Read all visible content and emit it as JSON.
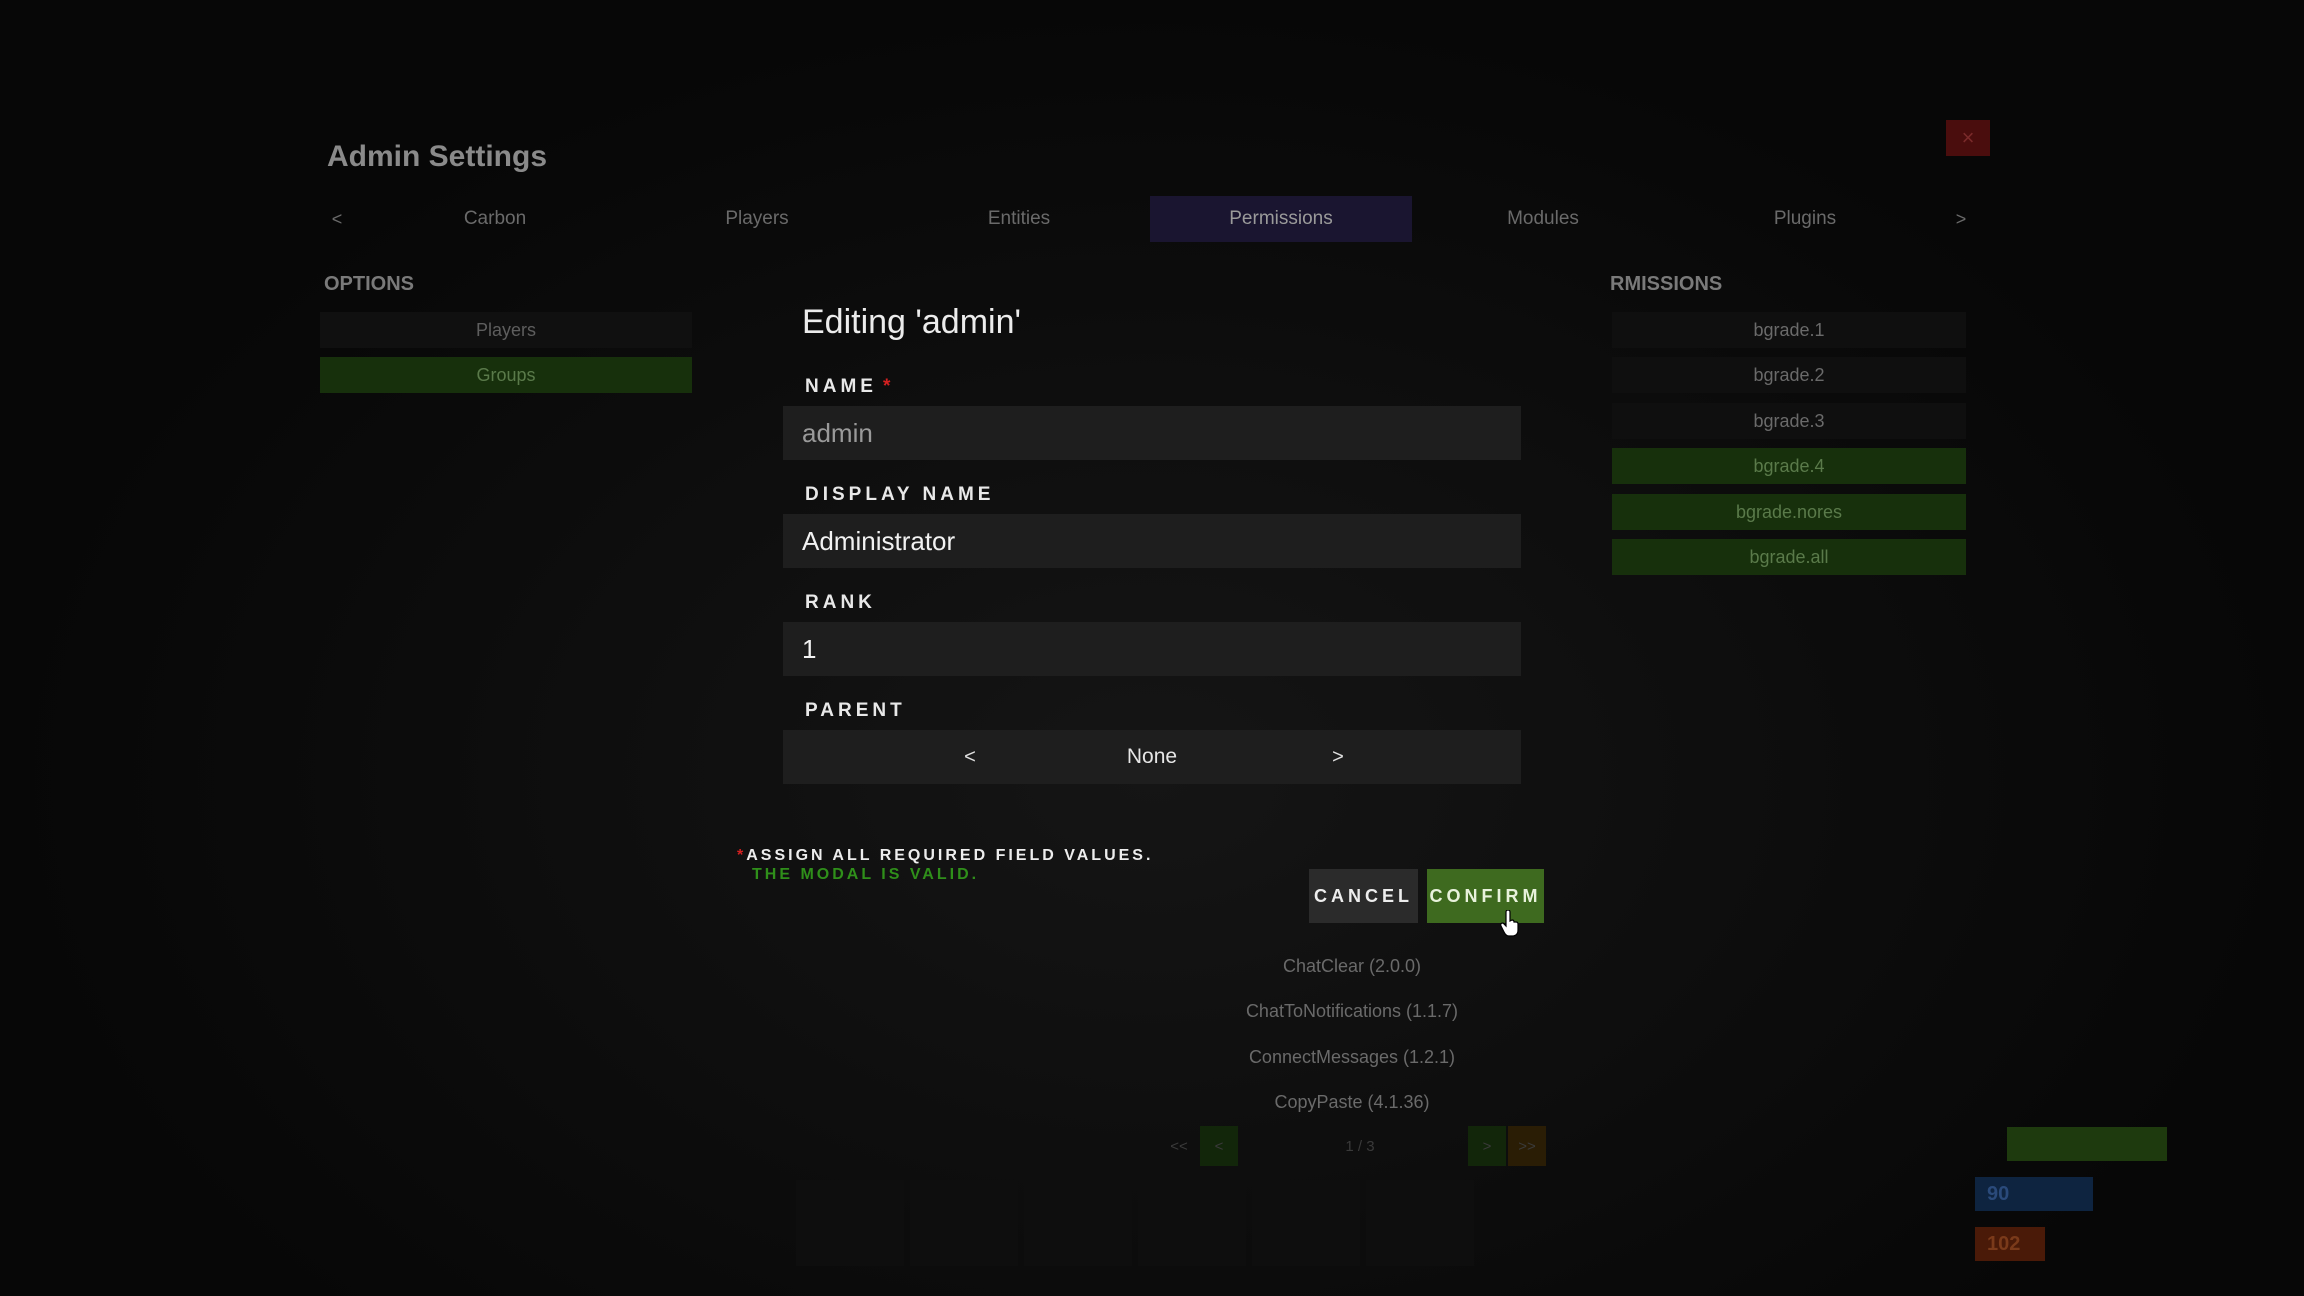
{
  "colors": {
    "background": "#0a0a0a",
    "accent_green": "#3e6a1f",
    "valid_text": "#2f8f1a",
    "required_red": "#d42020",
    "field_bg": "#1e1e1e"
  },
  "background_panel": {
    "title": "Admin Settings",
    "close_label": "×",
    "tabs": {
      "prev": "<",
      "next": ">",
      "items": [
        "Carbon",
        "Players",
        "Entities",
        "Permissions",
        "Modules",
        "Plugins"
      ],
      "active": "Permissions"
    },
    "options": {
      "heading": "OPTIONS",
      "items": [
        "Players",
        "Groups"
      ],
      "selected": "Groups"
    },
    "permissions": {
      "heading": "RMISSIONS",
      "items": [
        "bgrade.1",
        "bgrade.2",
        "bgrade.3",
        "bgrade.4",
        "bgrade.nores",
        "bgrade.all"
      ],
      "enabled": [
        "bgrade.4",
        "bgrade.nores",
        "bgrade.all"
      ]
    },
    "plugins": [
      "ChatClear (2.0.0)",
      "ChatToNotifications (1.1.7)",
      "ConnectMessages (1.2.1)",
      "CopyPaste (4.1.36)"
    ],
    "pager": {
      "first": "<<",
      "prev": "<",
      "page": "1 / 3",
      "next": ">",
      "last": ">>"
    },
    "stats": {
      "water": "90",
      "food": "102"
    }
  },
  "modal": {
    "title": "Editing 'admin'",
    "fields": {
      "name": {
        "label": "NAME",
        "required_mark": "*",
        "value": "admin"
      },
      "display_name": {
        "label": "DISPLAY NAME",
        "value": "Administrator"
      },
      "rank": {
        "label": "RANK",
        "value": "1"
      },
      "parent": {
        "label": "PARENT",
        "value": "None",
        "prev": "<",
        "next": ">"
      }
    },
    "footer": {
      "required_mark": "*",
      "required_note": "ASSIGN ALL REQUIRED FIELD VALUES.",
      "valid_note": "THE MODAL IS VALID."
    },
    "buttons": {
      "cancel": "CANCEL",
      "confirm": "CONFIRM"
    }
  }
}
